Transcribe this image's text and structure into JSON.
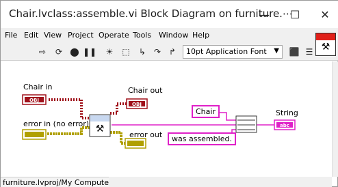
{
  "window": {
    "title": "Chair.lvclass:assemble.vi Block Diagram on furniture.⋯",
    "minimize_glyph": "—",
    "maximize_glyph": "☐",
    "close_glyph": "✕"
  },
  "menu": [
    "File",
    "Edit",
    "View",
    "Project",
    "Operate",
    "Tools",
    "Window",
    "Help"
  ],
  "toolbar": {
    "font_label": "10pt Application Font",
    "icons": [
      "run-arrow-icon",
      "run-continuous-icon",
      "abort-icon",
      "pause-icon",
      "highlight-bulb-icon",
      "retain-wire-icon",
      "step-into-icon",
      "step-over-icon",
      "step-out-icon",
      "align-icon",
      "distribute-icon",
      "reorder-icon"
    ]
  },
  "diagram": {
    "chair_in_label": "Chair in",
    "error_in_label": "error in (no error)",
    "chair_out_label": "Chair out",
    "error_out_label": "error out",
    "const_chair": "Chair",
    "const_assembled": "was assembled.",
    "string_label": "String",
    "obj_text": "OBJ",
    "abc_text": "abc"
  },
  "statusbar": {
    "path": "furniture.lvproj/My Computer"
  },
  "colors": {
    "class_wire": "#a0101a",
    "error_wire": "#b0a000",
    "string_wire": "#e020c8"
  }
}
